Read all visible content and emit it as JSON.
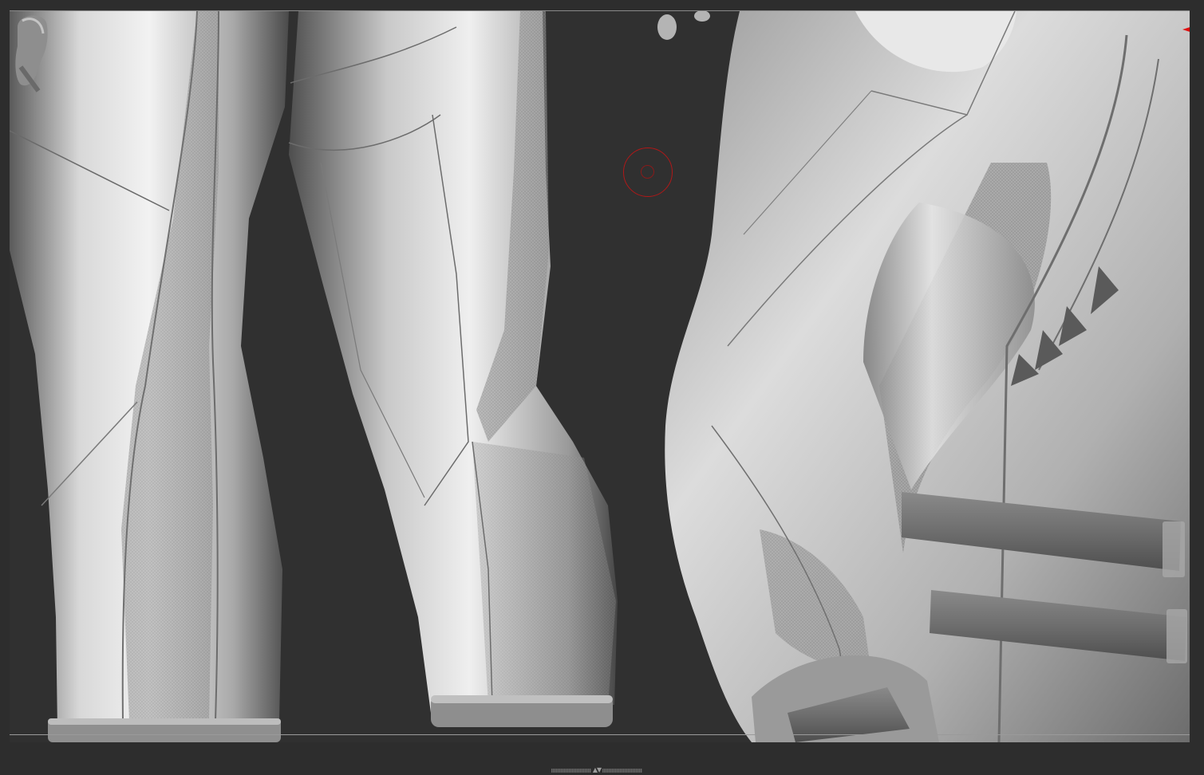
{
  "app": {
    "name": ""
  },
  "viewport": {
    "background": "#2d2d2d",
    "mesh_color": "#bcbcbc",
    "brush_cursor_color": "#b01818",
    "axis_marker_color": "#e01010"
  },
  "icons": {
    "brush_cursor": "brush-circle-icon",
    "axis_marker": "axis-arrow-icon",
    "orientation_gizmo": "gizmo-head-icon",
    "splitter_arrows": "up-down-arrows-icon"
  },
  "handle": {
    "arrows": "▲▼"
  }
}
